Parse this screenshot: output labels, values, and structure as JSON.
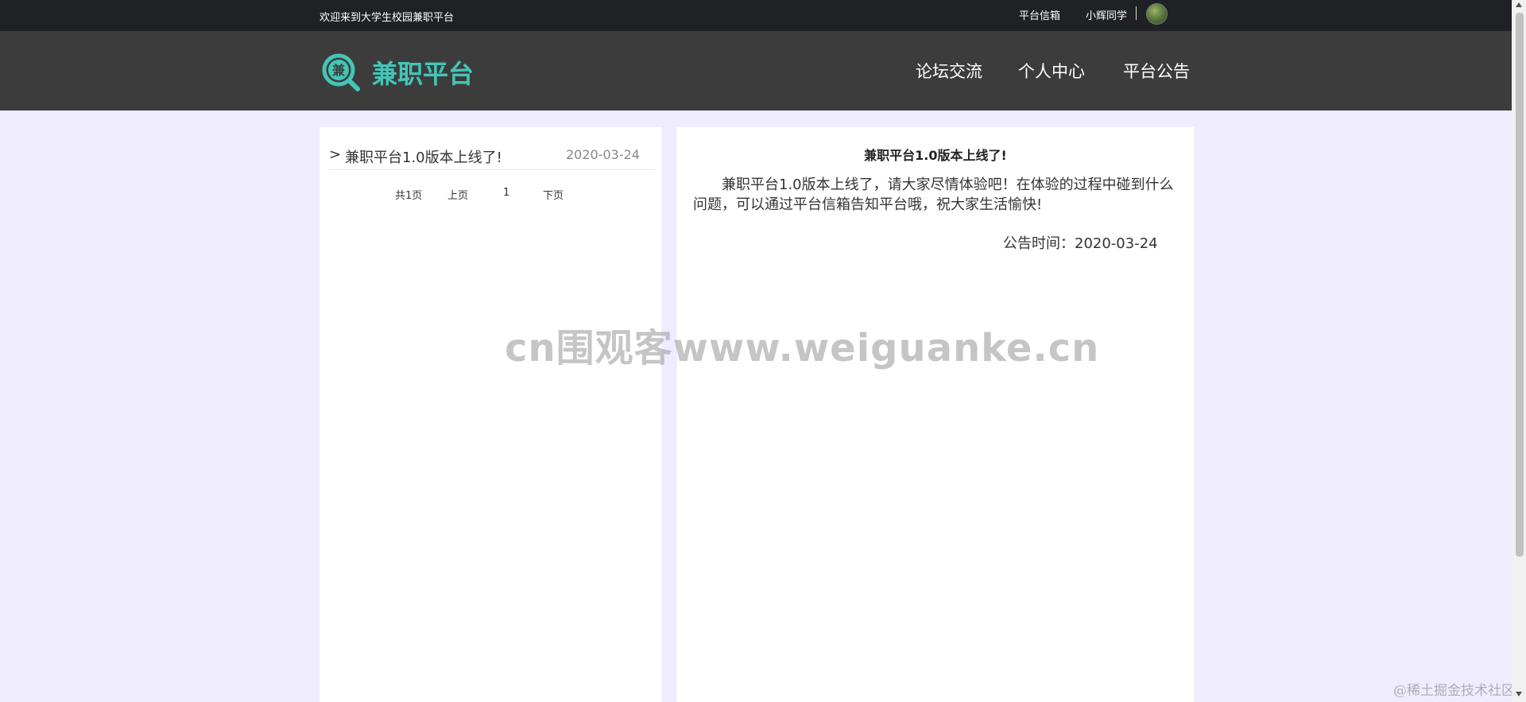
{
  "topbar": {
    "welcome": "欢迎来到大学生校园兼职平台",
    "mailbox": "平台信箱",
    "user": "小辉同学"
  },
  "header": {
    "logo_char": "兼",
    "brand": "兼职平台",
    "nav": [
      "论坛交流",
      "个人中心",
      "平台公告"
    ]
  },
  "notice_list": {
    "items": [
      {
        "arrow": ">",
        "title": "兼职平台1.0版本上线了!",
        "date": "2020-03-24"
      }
    ],
    "pager": {
      "total": "共1页",
      "prev": "上页",
      "current": "1",
      "next": "下页"
    }
  },
  "article": {
    "title": "兼职平台1.0版本上线了!",
    "body": "兼职平台1.0版本上线了，请大家尽情体验吧！在体验的过程中碰到什么问题，可以通过平台信箱告知平台哦，祝大家生活愉快!",
    "time_label": "公告时间：",
    "time": "2020-03-24"
  },
  "overlays": {
    "watermark": "cn围观客www.weiguanke.cn",
    "footer_mark": "@稀土掘金技术社区"
  },
  "colors": {
    "brand": "#43c6b6",
    "topbar": "#1f2125",
    "navbar": "#3c3c3d",
    "page_bg": "#efedfd"
  },
  "icons": {
    "logo": "search-magnifier-logo-icon",
    "avatar": "user-avatar"
  }
}
